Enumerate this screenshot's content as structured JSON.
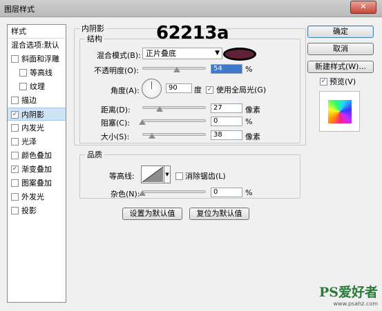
{
  "window": {
    "title": "图层样式",
    "close_label": "✕"
  },
  "left_panel": {
    "header": "样式",
    "items": [
      {
        "label": "混合选项:默认",
        "checkbox": false,
        "checked": false,
        "selected": false
      },
      {
        "label": "斜面和浮雕",
        "checkbox": true,
        "checked": false,
        "selected": false
      },
      {
        "label": "等高线",
        "checkbox": true,
        "checked": false,
        "selected": false
      },
      {
        "label": "纹理",
        "checkbox": true,
        "checked": false,
        "selected": false
      },
      {
        "label": "描边",
        "checkbox": true,
        "checked": false,
        "selected": false
      },
      {
        "label": "内阴影",
        "checkbox": true,
        "checked": true,
        "selected": true
      },
      {
        "label": "内发光",
        "checkbox": true,
        "checked": false,
        "selected": false
      },
      {
        "label": "光泽",
        "checkbox": true,
        "checked": false,
        "selected": false
      },
      {
        "label": "颜色叠加",
        "checkbox": true,
        "checked": false,
        "selected": false
      },
      {
        "label": "渐变叠加",
        "checkbox": true,
        "checked": true,
        "selected": false
      },
      {
        "label": "图案叠加",
        "checkbox": true,
        "checked": false,
        "selected": false
      },
      {
        "label": "外发光",
        "checkbox": true,
        "checked": false,
        "selected": false
      },
      {
        "label": "投影",
        "checkbox": true,
        "checked": false,
        "selected": false
      }
    ]
  },
  "inner_shadow": {
    "section_title": "内阴影",
    "structure_title": "结构",
    "annotation": "62213a",
    "blend_mode_label": "混合模式(B):",
    "blend_mode_value": "正片叠底",
    "color": "#62213a",
    "opacity_label": "不透明度(O):",
    "opacity_value": "54",
    "opacity_unit": "%",
    "opacity_level": 0.54,
    "angle_label": "角度(A):",
    "angle_value": "90",
    "angle_unit": "度",
    "global_light_label": "使用全局光(G)",
    "global_light_checked": true,
    "distance_label": "距离(D):",
    "distance_value": "27",
    "distance_unit": "像素",
    "distance_level": 0.27,
    "choke_label": "阻塞(C):",
    "choke_value": "0",
    "choke_unit": "%",
    "choke_level": 0,
    "size_label": "大小(S):",
    "size_value": "38",
    "size_unit": "像素",
    "size_level": 0.15
  },
  "quality": {
    "title": "品质",
    "contour_label": "等高线:",
    "anti_alias_label": "消除锯齿(L)",
    "anti_alias_checked": false,
    "noise_label": "杂色(N):",
    "noise_value": "0",
    "noise_unit": "%",
    "noise_level": 0
  },
  "buttons": {
    "set_default": "设置为默认值",
    "reset_default": "复位为默认值",
    "ok": "确定",
    "cancel": "取消",
    "new_style": "新建样式(W)...",
    "preview_label": "预览(V)",
    "preview_checked": true
  },
  "watermark": {
    "main": "PS爱好者",
    "sub": "www.psahz.com"
  }
}
